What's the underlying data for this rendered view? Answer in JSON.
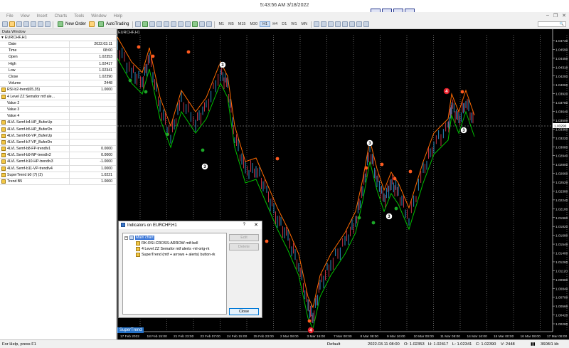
{
  "clock": "5:43:56 AM 3/18/2022",
  "menu": [
    "File",
    "View",
    "Insert",
    "Charts",
    "Tools",
    "Window",
    "Help"
  ],
  "toolbar": {
    "new_order": "New Order",
    "autotrading": "AutoTrading",
    "timeframes": [
      "M1",
      "M5",
      "M15",
      "M30",
      "H1",
      "H4",
      "D1",
      "W1",
      "MN"
    ],
    "active_timeframe": "H1"
  },
  "data_window": {
    "title": "Data Window",
    "symbol": "EURCHF,H1",
    "rows": [
      {
        "name": "Date",
        "value": "2022.03.11"
      },
      {
        "name": "Time",
        "value": "08:00"
      },
      {
        "name": "Open",
        "value": "1.02353"
      },
      {
        "name": "High",
        "value": "1.02417"
      },
      {
        "name": "Low",
        "value": "1.02341"
      },
      {
        "name": "Close",
        "value": "1.02390"
      },
      {
        "name": "Volume",
        "value": "2448"
      }
    ],
    "indicators": [
      {
        "name": "RSI-b2-trend(65,35)",
        "value": "1.0000",
        "icon": true
      },
      {
        "name": "4 Level ZZ Semafor mtf ale...",
        "value": "",
        "icon": true
      },
      {
        "name": "Value 2",
        "value": "",
        "icon": false
      },
      {
        "name": "Value 3",
        "value": "",
        "icon": false
      },
      {
        "name": "Value 4",
        "value": "",
        "icon": false
      },
      {
        "name": "4LVL Semf-b4-HP_BuferUp",
        "value": "",
        "icon": true
      },
      {
        "name": "4LVL Semf-b5-HP_BuferDn",
        "value": "",
        "icon": true
      },
      {
        "name": "4LVL Semf-b6-VP_BuferUp",
        "value": "",
        "icon": true
      },
      {
        "name": "4LVL Semf-b7-VP_BuferDn",
        "value": "",
        "icon": true
      },
      {
        "name": "4LVL Semf-b8-FP-trendlv1",
        "value": "0.0000",
        "icon": true
      },
      {
        "name": "4LVL Semf-b9-NP-trendlv2",
        "value": "0.0000",
        "icon": true
      },
      {
        "name": "4LVL Semf-b10-HP-trendlv3",
        "value": "-1.0000",
        "icon": true
      },
      {
        "name": "4LVL Semf-b11-VP-trendlv4",
        "value": "1.0000",
        "icon": true
      },
      {
        "name": "SuperTrend b0 (7) (2)",
        "value": "1.0221",
        "icon": true
      },
      {
        "name": "Trend B5",
        "value": "1.0000",
        "icon": true
      }
    ]
  },
  "chart": {
    "tab": "EURCHF,H1",
    "indicator_label": "SuperTrend",
    "price_labels": [
      "1.04730",
      "1.04590",
      "1.04450",
      "1.04310",
      "1.04200",
      "1.04060",
      "1.03920",
      "1.03780",
      "1.03640",
      "1.03500",
      "1.03360",
      "1.03220",
      "1.03080",
      "1.02940",
      "1.02800",
      "1.02660",
      "1.02520",
      "1.02380",
      "1.02240",
      "1.02100",
      "1.01960",
      "1.01820",
      "1.01680",
      "1.01540",
      "1.01400",
      "1.01260",
      "1.01120",
      "1.00980",
      "1.00840",
      "1.00700",
      "1.00560",
      "1.00420",
      "1.00280"
    ],
    "current_price": "1.03290",
    "time_labels": [
      "17 Feb 2022",
      "18 Feb 15:00",
      "21 Feb 23:00",
      "23 Feb 07:00",
      "24 Feb 15:00",
      "25 Feb 23:00",
      "2 Mar 08:00",
      "3 Mar 16:00",
      "7 Mar 00:00",
      "8 Mar 08:00",
      "9 Mar 16:00",
      "10 Mar 00:00",
      "11 Mar 08:00",
      "14 Mar 16:00",
      "15 Mar 00:00",
      "16 Mar 08:00",
      "17 Mar 08:00"
    ],
    "markers": [
      "3",
      "3",
      "3",
      "3",
      "4",
      "3",
      "4"
    ],
    "colors": {
      "up": "#00c000",
      "down": "#ff6a00",
      "bg": "#000000"
    }
  },
  "dialog": {
    "title": "Indicators on EURCHF,H1",
    "help": "?",
    "close_x": "✕",
    "root": "Main chart",
    "items": [
      "RK-RSI-CROSS-ARROW mtf-bell",
      "4 Level ZZ Semafor mtf alerts -ml-orig-rk",
      "SuperTrend (mtf + arrows + alerts) button-rk"
    ],
    "edit": "Edit",
    "delete": "Delete",
    "close": "Close"
  },
  "status": {
    "help": "For Help, press F1",
    "profile": "Default",
    "time": "2022.03.11 08:00",
    "open": "O: 1.02353",
    "high": "H: 1.02417",
    "low": "L: 1.02341",
    "close": "C: 1.02390",
    "volume": "V: 2448",
    "traffic": "3608/1 kb"
  }
}
